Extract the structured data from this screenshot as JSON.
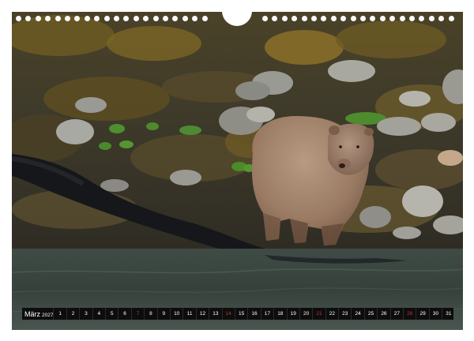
{
  "calendar": {
    "month": "März",
    "year": "2027",
    "days": [
      {
        "n": "1",
        "sun": false
      },
      {
        "n": "2",
        "sun": false
      },
      {
        "n": "3",
        "sun": false
      },
      {
        "n": "4",
        "sun": false
      },
      {
        "n": "5",
        "sun": false
      },
      {
        "n": "6",
        "sun": false
      },
      {
        "n": "7",
        "sun": true
      },
      {
        "n": "8",
        "sun": false
      },
      {
        "n": "9",
        "sun": false
      },
      {
        "n": "10",
        "sun": false
      },
      {
        "n": "11",
        "sun": false
      },
      {
        "n": "12",
        "sun": false
      },
      {
        "n": "13",
        "sun": false
      },
      {
        "n": "14",
        "sun": true
      },
      {
        "n": "15",
        "sun": false
      },
      {
        "n": "16",
        "sun": false
      },
      {
        "n": "17",
        "sun": false
      },
      {
        "n": "18",
        "sun": false
      },
      {
        "n": "19",
        "sun": false
      },
      {
        "n": "20",
        "sun": false
      },
      {
        "n": "21",
        "sun": true
      },
      {
        "n": "22",
        "sun": false
      },
      {
        "n": "23",
        "sun": false
      },
      {
        "n": "24",
        "sun": false
      },
      {
        "n": "25",
        "sun": false
      },
      {
        "n": "26",
        "sun": false
      },
      {
        "n": "27",
        "sun": false
      },
      {
        "n": "28",
        "sun": true
      },
      {
        "n": "29",
        "sun": false
      },
      {
        "n": "30",
        "sun": false
      },
      {
        "n": "31",
        "sun": false
      }
    ]
  },
  "colors": {
    "page": "#ffffff",
    "strip": "#0d0d0d",
    "weekday_text": "#ffffff",
    "sunday_text": "#c8322b",
    "bear_fur": "#9a7a62",
    "water": "#3b4842",
    "kelp_band": "#1a1c1e"
  }
}
